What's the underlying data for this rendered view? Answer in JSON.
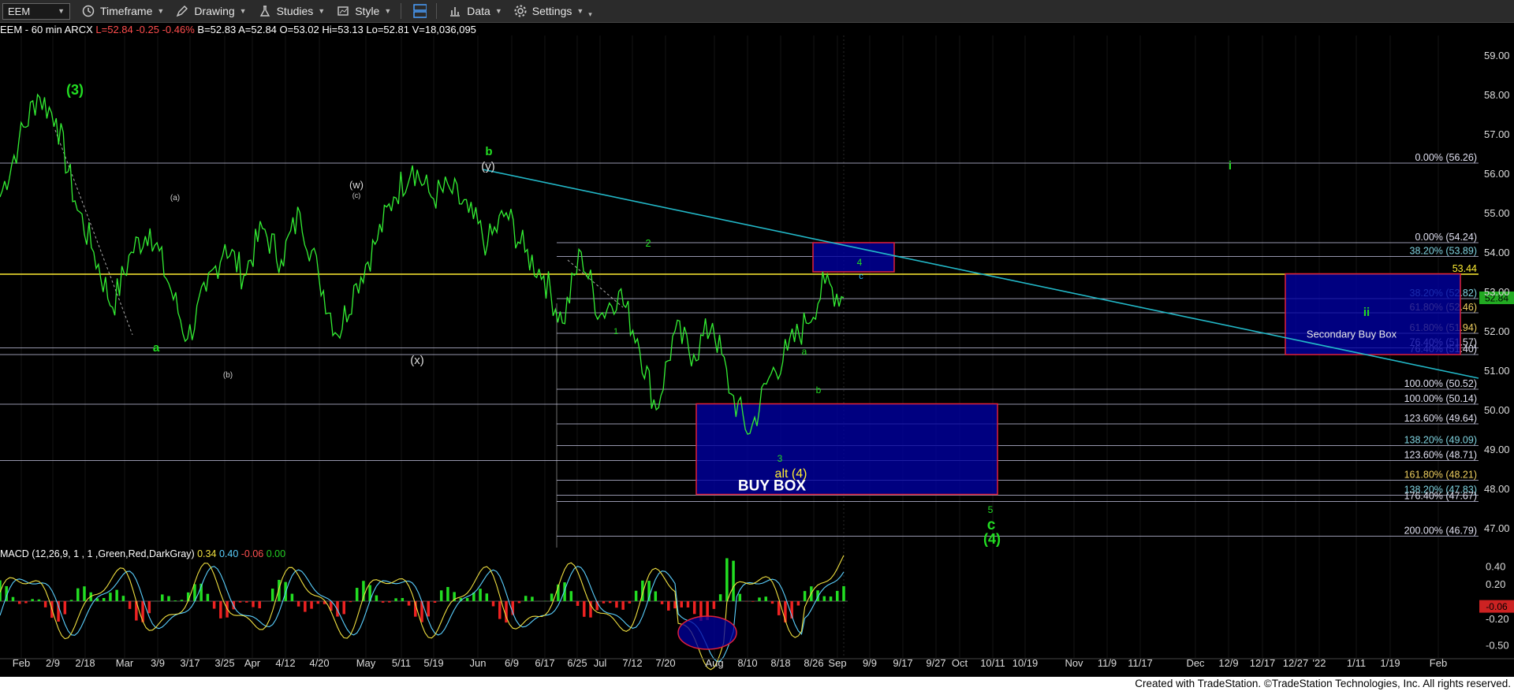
{
  "toolbar": {
    "symbol": "EEM",
    "items": [
      {
        "label": "Timeframe",
        "icon": "clock-icon"
      },
      {
        "label": "Drawing",
        "icon": "pencil-icon"
      },
      {
        "label": "Studies",
        "icon": "flask-icon"
      },
      {
        "label": "Style",
        "icon": "chart-style-icon"
      },
      {
        "label": "Data",
        "icon": "bar-chart-icon"
      },
      {
        "label": "Settings",
        "icon": "gear-icon"
      }
    ]
  },
  "info": {
    "symbol_line": "EEM - 60 min  ARCX",
    "last": "L=52.84  -0.25  -0.46%",
    "rest": "B=52.83  A=52.84  O=53.02  Hi=53.13  Lo=52.81  V=18,036,095"
  },
  "macd": {
    "label": "MACD (12,26,9, 1 , 1 ,Green,Red,DarkGray)",
    "v1": "0.34",
    "v2": "0.40",
    "v3": "-0.06",
    "v4": "0.00"
  },
  "footer": "Created with TradeStation. ©TradeStation Technologies, Inc. All rights reserved.",
  "colors": {
    "price": "#33ee33",
    "fib": "#c8c8e6",
    "box": "#0000a0",
    "trend": "#22b8c8",
    "yellow": "#ffee33"
  },
  "chart_data": {
    "type": "line",
    "symbol": "EEM",
    "interval": "60 min",
    "ylim": [
      46.5,
      59.5
    ],
    "price_axis_ticks": [
      59.0,
      58.0,
      57.0,
      56.0,
      55.0,
      54.0,
      53.0,
      52.0,
      51.0,
      50.0,
      49.0,
      48.0,
      47.0
    ],
    "x_labels": [
      "Feb",
      "2/9",
      "2/18",
      "Mar",
      "3/9",
      "3/17",
      "3/25",
      "Apr",
      "4/12",
      "4/20",
      "May",
      "5/11",
      "5/19",
      "Jun",
      "6/9",
      "6/17",
      "6/25",
      "Jul",
      "7/12",
      "7/20",
      "Aug",
      "8/10",
      "8/18",
      "8/26",
      "Sep",
      "9/9",
      "9/17",
      "9/27",
      "Oct",
      "10/11",
      "10/19",
      "Nov",
      "11/9",
      "11/17",
      "Dec",
      "12/9",
      "12/17",
      "12/27",
      "'22",
      "1/11",
      "1/19",
      "Feb"
    ],
    "series": [
      {
        "values": [
          55.4,
          56.8,
          58.0,
          57.4,
          55.3,
          54.0,
          52.6,
          54.0,
          54.6,
          53.2,
          51.8,
          53.0,
          54.2,
          53.4,
          54.6,
          53.8,
          55.0,
          53.4,
          51.9,
          53.2,
          54.2,
          55.4,
          56.2,
          55.4,
          55.6,
          55.0,
          54.2,
          55.0,
          54.0,
          53.4,
          52.2,
          54.0,
          52.4,
          53.0,
          51.8,
          50.0,
          52.0,
          51.4,
          52.2,
          50.4,
          49.4,
          50.8,
          51.5,
          52.2,
          53.2,
          52.84
        ]
      }
    ],
    "current_price": "52.84",
    "price_level": "53.44",
    "fib_levels": [
      {
        "label": "0.00% (56.26)",
        "value": 56.26
      },
      {
        "label": "0.00% (54.24)",
        "value": 54.24
      },
      {
        "label": "38.20% (53.89)",
        "value": 53.89
      },
      {
        "label": "38.20% (52.82)",
        "value": 52.82
      },
      {
        "label": "61.80% (52.46)",
        "value": 52.46
      },
      {
        "label": "61.80% (51.94)",
        "value": 51.94
      },
      {
        "label": "76.40% (51.57)",
        "value": 51.57
      },
      {
        "label": "76.40% (51.40)",
        "value": 51.4
      },
      {
        "label": "100.00% (50.52)",
        "value": 50.52
      },
      {
        "label": "100.00% (50.14)",
        "value": 50.14
      },
      {
        "label": "123.60% (49.64)",
        "value": 49.64
      },
      {
        "label": "138.20% (49.09)",
        "value": 49.09
      },
      {
        "label": "123.60% (48.71)",
        "value": 48.71
      },
      {
        "label": "161.80% (48.21)",
        "value": 48.21
      },
      {
        "label": "138.20% (47.83)",
        "value": 47.83
      },
      {
        "label": "176.40% (47.67)",
        "value": 47.67
      },
      {
        "label": "200.00% (46.79)",
        "value": 46.79
      }
    ],
    "boxes": [
      {
        "label": "BUY BOX",
        "top": 50.15,
        "bottom": 47.85
      },
      {
        "label": "Secondary Buy Box",
        "top": 53.45,
        "bottom": 51.4
      },
      {
        "label": "",
        "top": 54.24,
        "bottom": 53.5
      }
    ],
    "wave_labels": [
      "(3)",
      "a",
      "(a)",
      "(b)",
      "(w)",
      "(c)",
      "(x)",
      "b",
      "(y)",
      "1",
      "2",
      "3",
      "a",
      "b",
      "c",
      "4",
      "alt (4)",
      "5",
      "c",
      "(4)",
      "i",
      "ii"
    ],
    "macd_axis_ticks": [
      "0.40",
      "0.20",
      "-0.20",
      "-0.50"
    ],
    "macd_current": "-0.06"
  }
}
